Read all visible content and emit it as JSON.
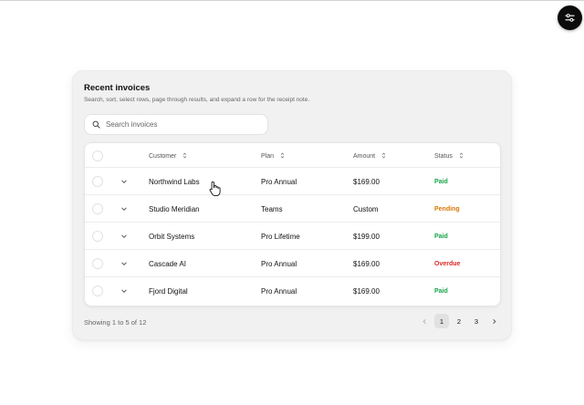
{
  "card": {
    "title": "Recent invoices",
    "subtitle": "Search, sort, select rows, page through results, and expand a row for the receipt note."
  },
  "search": {
    "placeholder": "Search invoices",
    "icon": "search-icon"
  },
  "table": {
    "headers": {
      "customer": "Customer",
      "plan": "Plan",
      "amount": "Amount",
      "status": "Status"
    },
    "rows": [
      {
        "customer": "Northwind Labs",
        "plan": "Pro Annual",
        "amount": "$169.00",
        "status": "Paid"
      },
      {
        "customer": "Studio Meridian",
        "plan": "Teams",
        "amount": "Custom",
        "status": "Pending"
      },
      {
        "customer": "Orbit Systems",
        "plan": "Pro Lifetime",
        "amount": "$199.00",
        "status": "Paid"
      },
      {
        "customer": "Cascade AI",
        "plan": "Pro Annual",
        "amount": "$169.00",
        "status": "Overdue"
      },
      {
        "customer": "Fjord Digital",
        "plan": "Pro Annual",
        "amount": "$169.00",
        "status": "Paid"
      }
    ]
  },
  "status_colors": {
    "Paid": "#16a34a",
    "Pending": "#d97706",
    "Overdue": "#dc2626"
  },
  "footer": {
    "summary": "Showing 1 to 5 of 12"
  },
  "pagination": {
    "pages": [
      "1",
      "2",
      "3"
    ],
    "current": "1"
  }
}
